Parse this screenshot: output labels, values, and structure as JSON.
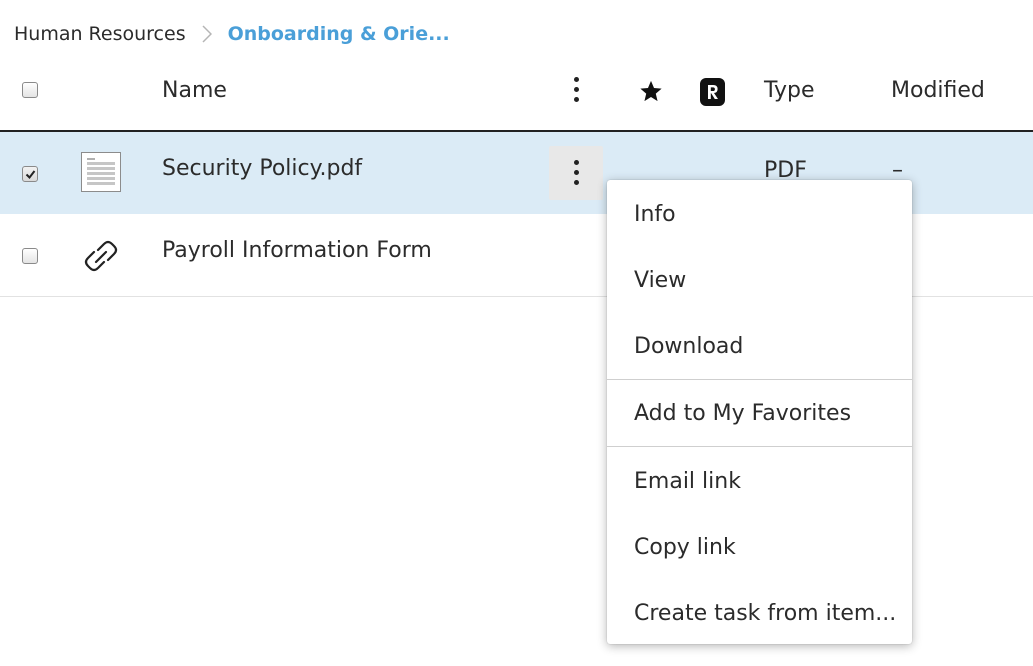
{
  "breadcrumb": {
    "root": "Human Resources",
    "current": "Onboarding & Orie..."
  },
  "header": {
    "name": "Name",
    "type": "Type",
    "modified": "Modified",
    "icons": [
      "kebab-icon",
      "star-icon",
      "r-badge-icon"
    ]
  },
  "rows": [
    {
      "name": "Security Policy.pdf",
      "type": "PDF",
      "modified": "–",
      "icon": "pdf-document-icon",
      "checked": true,
      "selected": true
    },
    {
      "name": "Payroll Information Form",
      "type": "",
      "modified": "",
      "icon": "link-icon",
      "checked": false,
      "selected": false
    }
  ],
  "context_menu": {
    "items": [
      {
        "label": "Info"
      },
      {
        "label": "View"
      },
      {
        "label": "Download"
      },
      {
        "label": "Add to My Favorites"
      },
      {
        "label": "Email link"
      },
      {
        "label": "Copy link"
      },
      {
        "label": "Create task from item..."
      }
    ]
  },
  "colors": {
    "accent": "#4a9fd8",
    "selected_row": "#dbebf6",
    "text": "#2b2b2b"
  }
}
